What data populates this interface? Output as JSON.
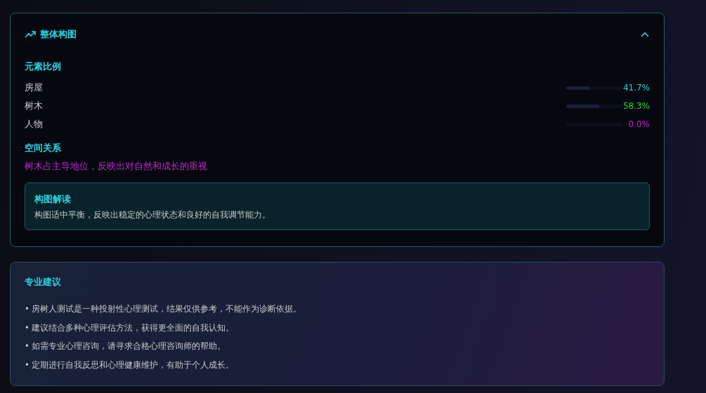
{
  "composition": {
    "title": "整体构图",
    "expanded": true,
    "proportions": {
      "title": "元素比例",
      "items": [
        {
          "label": "房屋",
          "level": 0.417,
          "reading": "41.7%",
          "color": "#2ad4e0"
        },
        {
          "label": "树木",
          "level": 0.583,
          "reading": "58.3%",
          "color": "#22d822"
        },
        {
          "label": "人物",
          "level": 0,
          "reading": "0.0%",
          "color": "#cc22cc"
        }
      ]
    },
    "spatial": {
      "title": "空间关系",
      "text": "树木占主导地位，反映出对自然和成长的重视"
    },
    "interpretation": {
      "title": "构图解读",
      "text": "构图适中平衡，反映出稳定的心理状态和良好的自我调节能力。"
    }
  },
  "advice": {
    "title": "专业建议",
    "items": [
      "• 房树人测试是一种投射性心理测试，结果仅供参考，不能作为诊断依据。",
      "• 建议结合多种心理评估方法，获得更全面的自我认知。",
      "• 如需专业心理咨询，请寻求合格心理咨询师的帮助。",
      "• 定期进行自我反思和心理健康维护，有助于个人成长。"
    ]
  }
}
